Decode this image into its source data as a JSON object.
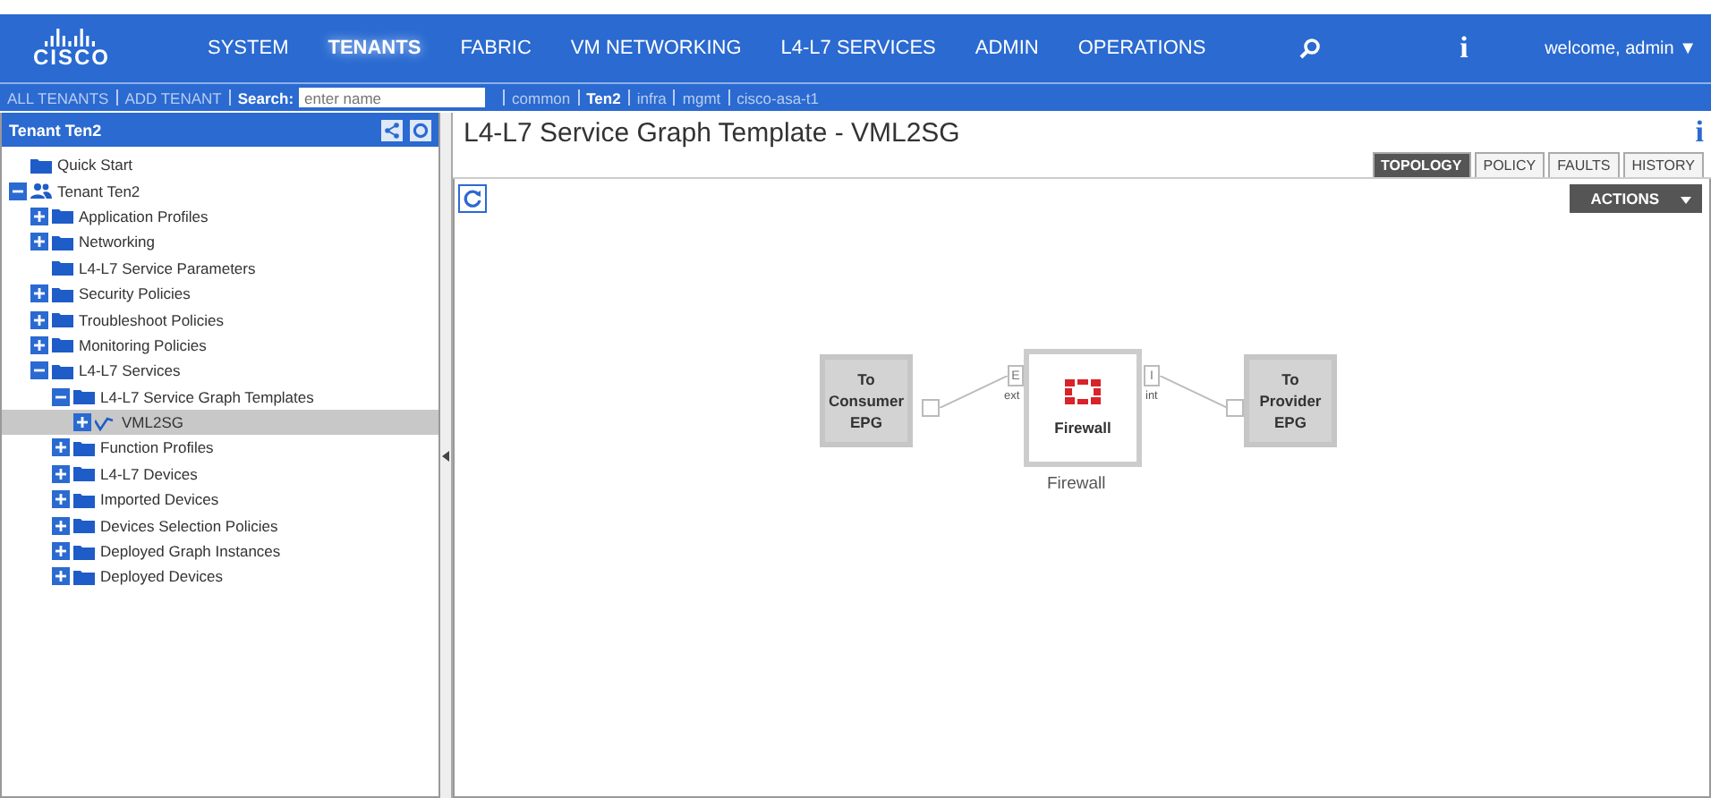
{
  "top_nav": {
    "logo": "CISCO",
    "items": [
      {
        "label": "SYSTEM",
        "selected": false
      },
      {
        "label": "TENANTS",
        "selected": true
      },
      {
        "label": "FABRIC",
        "selected": false
      },
      {
        "label": "VM NETWORKING",
        "selected": false
      },
      {
        "label": "L4-L7 SERVICES",
        "selected": false
      },
      {
        "label": "ADMIN",
        "selected": false
      },
      {
        "label": "OPERATIONS",
        "selected": false
      }
    ],
    "info": "i",
    "user": "welcome, admin ▼"
  },
  "sub_nav": {
    "links": [
      "ALL TENANTS",
      "ADD TENANT"
    ],
    "search_label": "Search:",
    "search_placeholder": "enter name",
    "tenants": [
      {
        "label": "common",
        "selected": false
      },
      {
        "label": "Ten2",
        "selected": true
      },
      {
        "label": "infra",
        "selected": false
      },
      {
        "label": "mgmt",
        "selected": false
      },
      {
        "label": "cisco-asa-t1",
        "selected": false
      }
    ]
  },
  "sidebar": {
    "title": "Tenant Ten2",
    "items": [
      {
        "label": "Quick Start",
        "kind": "folder",
        "expandable": false,
        "selected": false
      },
      {
        "label": "Tenant Ten2",
        "kind": "tenant",
        "expandable": true,
        "expanded": true,
        "selected": false,
        "children": [
          {
            "label": "Application Profiles",
            "kind": "folder",
            "expandable": true,
            "expanded": false,
            "selected": false
          },
          {
            "label": "Networking",
            "kind": "folder",
            "expandable": true,
            "expanded": false,
            "selected": false
          },
          {
            "label": "L4-L7 Service Parameters",
            "kind": "folder",
            "expandable": false,
            "selected": false
          },
          {
            "label": "Security Policies",
            "kind": "folder",
            "expandable": true,
            "expanded": false,
            "selected": false
          },
          {
            "label": "Troubleshoot Policies",
            "kind": "folder",
            "expandable": true,
            "expanded": false,
            "selected": false
          },
          {
            "label": "Monitoring Policies",
            "kind": "folder",
            "expandable": true,
            "expanded": false,
            "selected": false
          },
          {
            "label": "L4-L7 Services",
            "kind": "folder",
            "expandable": true,
            "expanded": true,
            "selected": false,
            "children": [
              {
                "label": "L4-L7 Service Graph Templates",
                "kind": "folder",
                "expandable": true,
                "expanded": true,
                "selected": false,
                "children": [
                  {
                    "label": "VML2SG",
                    "kind": "graph",
                    "expandable": true,
                    "expanded": false,
                    "selected": true
                  }
                ]
              },
              {
                "label": "Function Profiles",
                "kind": "folder",
                "expandable": true,
                "expanded": false,
                "selected": false
              },
              {
                "label": "L4-L7 Devices",
                "kind": "folder",
                "expandable": true,
                "expanded": false,
                "selected": false
              },
              {
                "label": "Imported Devices",
                "kind": "folder",
                "expandable": true,
                "expanded": false,
                "selected": false
              },
              {
                "label": "Devices Selection Policies",
                "kind": "folder",
                "expandable": true,
                "expanded": false,
                "selected": false
              },
              {
                "label": "Deployed Graph Instances",
                "kind": "folder",
                "expandable": true,
                "expanded": false,
                "selected": false
              },
              {
                "label": "Deployed Devices",
                "kind": "folder",
                "expandable": true,
                "expanded": false,
                "selected": false
              }
            ]
          }
        ]
      }
    ]
  },
  "main": {
    "title": "L4-L7 Service Graph Template - VML2SG",
    "info": "i",
    "tabs": [
      {
        "label": "TOPOLOGY",
        "selected": true
      },
      {
        "label": "POLICY",
        "selected": false
      },
      {
        "label": "FAULTS",
        "selected": false
      },
      {
        "label": "HISTORY",
        "selected": false
      }
    ],
    "actions": "ACTIONS",
    "graph": {
      "consumer": "To Consumer EPG",
      "provider": "To Provider EPG",
      "node": {
        "name": "Firewall",
        "caption": "Firewall",
        "ext_port": "E",
        "ext_label": "ext",
        "int_port": "I",
        "int_label": "int"
      }
    }
  }
}
